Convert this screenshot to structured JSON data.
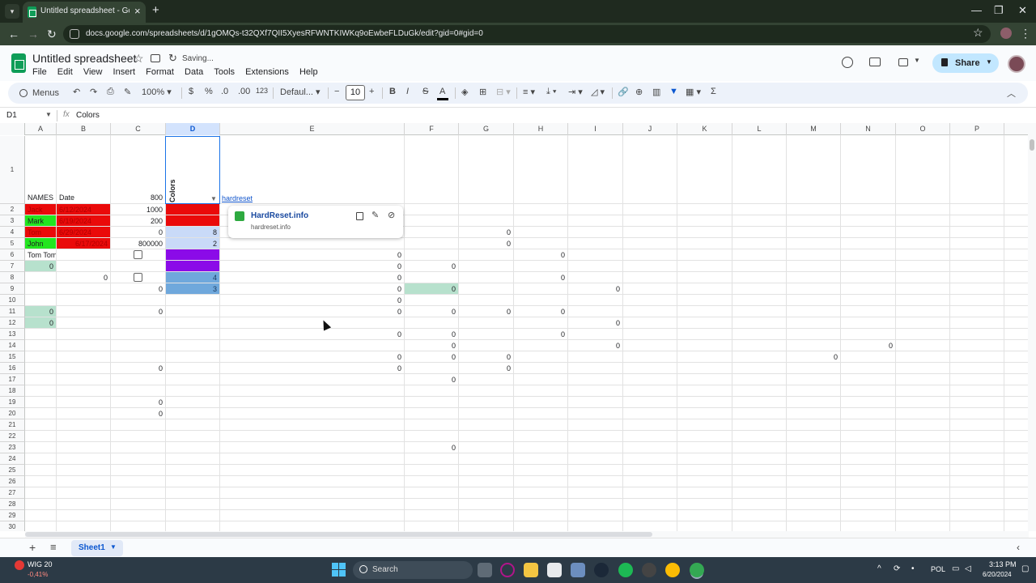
{
  "browser": {
    "tab_title": "Untitled spreadsheet - Google S",
    "url": "docs.google.com/spreadsheets/d/1gOMQs-t32QXf7QII5XyesRFWNTKIWKq9oEwbeFLDuGk/edit?gid=0#gid=0"
  },
  "app": {
    "title": "Untitled spreadsheet",
    "saving": "Saving...",
    "menu": [
      "File",
      "Edit",
      "View",
      "Insert",
      "Format",
      "Data",
      "Tools",
      "Extensions",
      "Help"
    ],
    "share": "Share"
  },
  "toolbar": {
    "menus": "Menus",
    "zoom": "100%",
    "currency": "$",
    "percent": "%",
    "dec_decrease": ".0",
    "dec_increase": ".00",
    "number_format": "123",
    "font": "Defaul...",
    "font_size": "10",
    "bold": "B",
    "italic": "I",
    "strike": "S",
    "text_color": "A",
    "sum": "Σ"
  },
  "formula_bar": {
    "name_box": "D1",
    "fx": "fx",
    "content": "Colors"
  },
  "grid": {
    "columns": [
      "A",
      "B",
      "C",
      "D",
      "E",
      "F",
      "G",
      "H",
      "I",
      "J",
      "K",
      "L",
      "M",
      "N",
      "O",
      "P"
    ],
    "selected_column": "D",
    "rows": [
      "1",
      "2",
      "3",
      "4",
      "5",
      "6",
      "7",
      "8",
      "9",
      "10",
      "11",
      "12",
      "13",
      "14",
      "15",
      "16",
      "17",
      "18",
      "19",
      "20",
      "21",
      "22",
      "23",
      "24",
      "25",
      "26",
      "27",
      "28",
      "29",
      "30"
    ],
    "a1": "NAMES",
    "b1": "Date",
    "c1": "800",
    "d1": "Colors",
    "e1": "hardreset",
    "names": [
      "Jack",
      "Mark",
      "Tom",
      "John",
      "Tom Tom"
    ],
    "dates": [
      "6/12/2024",
      "6/19/2024",
      "6/29/2024",
      "6/17/2024"
    ],
    "c_values": [
      "1000",
      "200",
      "0",
      "800000"
    ],
    "d_values": [
      "",
      "",
      "8",
      "2",
      "",
      "",
      "4",
      "3"
    ],
    "zero": "0"
  },
  "link_popup": {
    "title": "HardReset.info",
    "url": "hardreset.info"
  },
  "sheet_tabs": {
    "active": "Sheet1"
  },
  "taskbar": {
    "stock_name": "WIG 20",
    "stock_change": "-0,41%",
    "search": "Search",
    "lang": "POL",
    "time": "3:13 PM",
    "date": "6/20/2024"
  }
}
